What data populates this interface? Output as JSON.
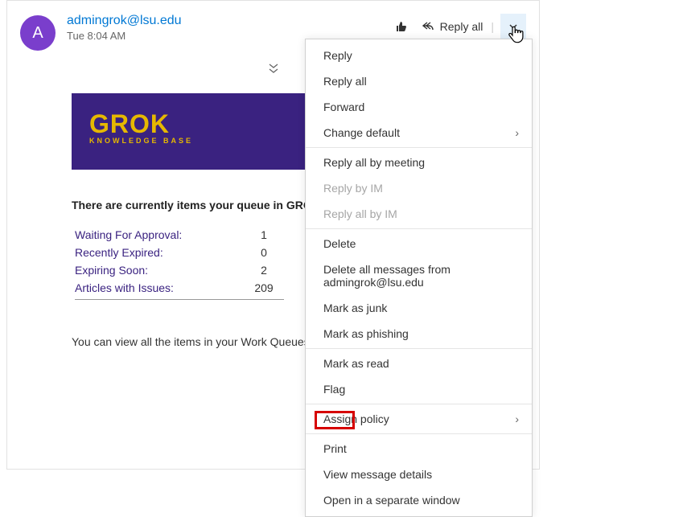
{
  "header": {
    "avatar_initial": "A",
    "sender_email": "admingrok@lsu.edu",
    "timestamp": "Tue 8:04 AM",
    "toolbar": {
      "reply_all_label": "Reply all"
    }
  },
  "banner": {
    "title": "GROK",
    "subtitle": "KNOWLEDGE BASE"
  },
  "body": {
    "queue_intro": "There are currently items your queue in GROK whi",
    "view_hint": "You can view all the items in your Work Queues on",
    "stats": [
      {
        "label": "Waiting For Approval:",
        "value": "1"
      },
      {
        "label": "Recently Expired:",
        "value": "0"
      },
      {
        "label": "Expiring Soon:",
        "value": "2"
      },
      {
        "label": "Articles with Issues:",
        "value": "209"
      }
    ]
  },
  "menu": {
    "reply": "Reply",
    "reply_all": "Reply all",
    "forward": "Forward",
    "change_default": "Change default",
    "reply_all_meeting": "Reply all by meeting",
    "reply_im": "Reply by IM",
    "reply_all_im": "Reply all by IM",
    "delete": "Delete",
    "delete_all_from": "Delete all messages from admingrok@lsu.edu",
    "mark_junk": "Mark as junk",
    "mark_phishing": "Mark as phishing",
    "mark_read": "Mark as read",
    "flag": "Flag",
    "assign_policy": "Assign policy",
    "print": "Print",
    "view_details": "View message details",
    "open_window": "Open in a separate window"
  }
}
